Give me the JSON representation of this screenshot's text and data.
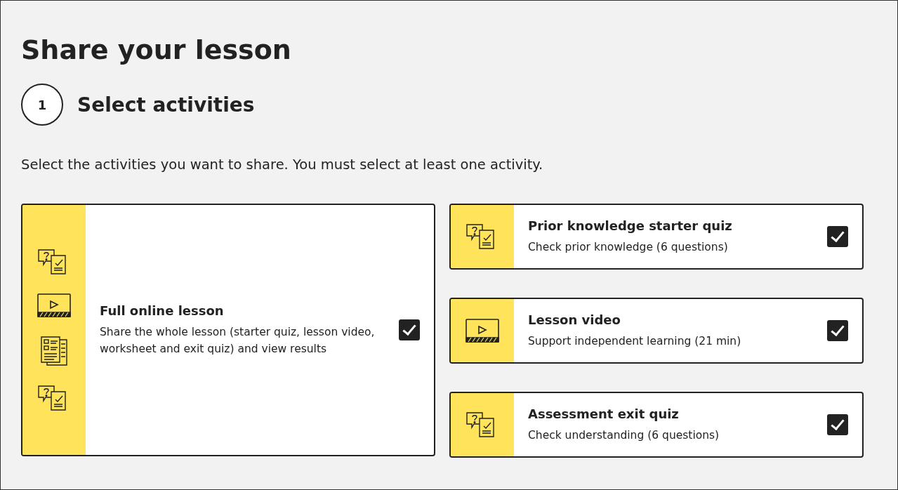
{
  "title": "Share your lesson",
  "step": {
    "number": "1",
    "title": "Select activities"
  },
  "description": "Select the activities you want to share. You must select at least one activity.",
  "full_lesson": {
    "title": "Full online lesson",
    "subtitle": "Share the whole lesson (starter quiz, lesson video, worksheet and exit quiz) and view results",
    "checked": true,
    "icons": [
      {
        "kind": "quiz"
      },
      {
        "kind": "video"
      },
      {
        "kind": "worksheet"
      },
      {
        "kind": "quiz"
      }
    ]
  },
  "activities": [
    {
      "kind": "quiz",
      "title": "Prior knowledge starter quiz",
      "subtitle": "Check prior knowledge (6 questions)",
      "checked": true
    },
    {
      "kind": "video",
      "title": "Lesson video",
      "subtitle": "Support independent learning (21 min)",
      "checked": true
    },
    {
      "kind": "quiz",
      "title": "Assessment exit quiz",
      "subtitle": "Check understanding (6 questions)",
      "checked": true
    }
  ]
}
